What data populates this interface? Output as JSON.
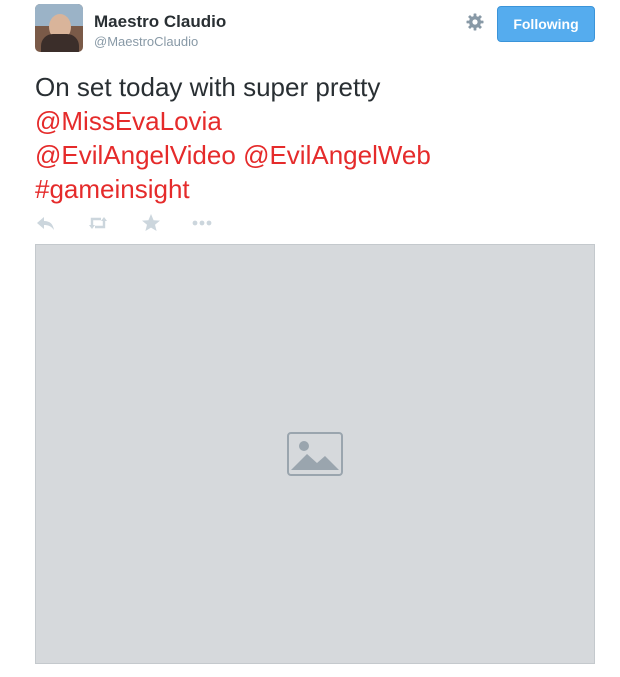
{
  "user": {
    "name": "Maestro Claudio",
    "handle": "@MaestroClaudio"
  },
  "header": {
    "follow_label": "Following",
    "settings_icon": "gear-icon"
  },
  "tweet": {
    "line1": "On set today with super pretty",
    "line2": "@MissEvaLovia",
    "line3a": "@EvilAngelVideo",
    "line3b": "@EvilAngelWeb",
    "line4": "#gameinsight"
  },
  "actions": {
    "icons": [
      "reply-icon",
      "retweet-icon",
      "favorite-icon",
      "more-icon"
    ]
  },
  "colors": {
    "accent": "#55acee",
    "link": "#e52b2b",
    "text": "#292f33",
    "muted": "#8899a6",
    "icon": "#ccd6dd"
  }
}
